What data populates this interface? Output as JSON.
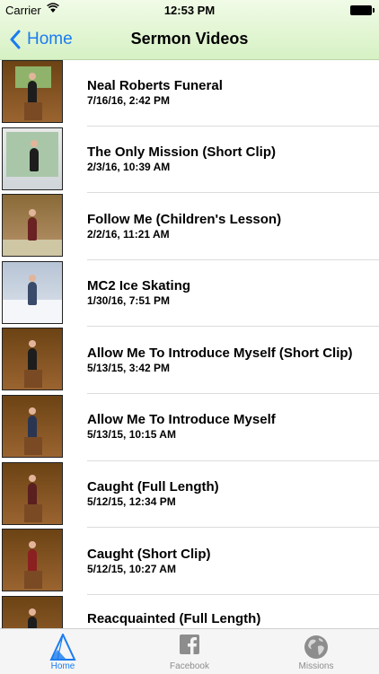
{
  "status_bar": {
    "carrier": "Carrier",
    "time": "12:53 PM"
  },
  "nav": {
    "back_label": "Home",
    "title": "Sermon Videos"
  },
  "videos": [
    {
      "title": "Neal Roberts Funeral",
      "date": "7/16/16, 2:42 PM"
    },
    {
      "title": "The Only Mission (Short Clip)",
      "date": "2/3/16, 10:39 AM"
    },
    {
      "title": "Follow Me (Children's Lesson)",
      "date": "2/2/16, 11:21 AM"
    },
    {
      "title": "MC2 Ice Skating",
      "date": "1/30/16, 7:51 PM"
    },
    {
      "title": "Allow Me To Introduce Myself (Short Clip)",
      "date": "5/13/15, 3:42 PM"
    },
    {
      "title": "Allow Me To Introduce Myself",
      "date": "5/13/15, 10:15 AM"
    },
    {
      "title": "Caught (Full Length)",
      "date": "5/12/15, 12:34 PM"
    },
    {
      "title": "Caught (Short Clip)",
      "date": "5/12/15, 10:27 AM"
    },
    {
      "title": "Reacquainted (Full Length)",
      "date": ""
    }
  ],
  "tabbar": {
    "home_label": "Home",
    "facebook_label": "Facebook",
    "missions_label": "Missions"
  },
  "colors": {
    "accent": "#1a7cf0",
    "nav_top": "#f1fbe7",
    "nav_bottom": "#d6f1c4"
  }
}
